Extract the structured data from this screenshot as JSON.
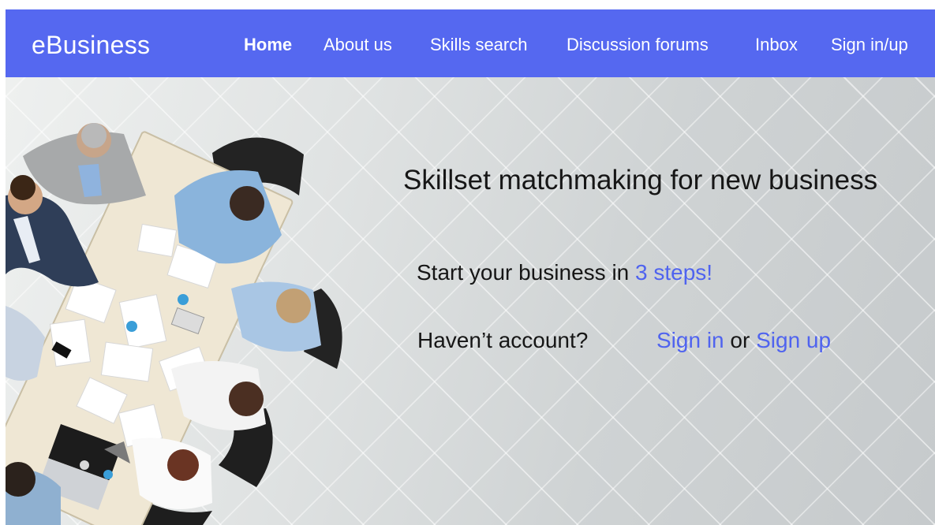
{
  "nav": {
    "brand": "eBusiness",
    "items": [
      {
        "label": "Home",
        "active": true
      },
      {
        "label": "About us",
        "active": false
      },
      {
        "label": "Skills search",
        "active": false
      },
      {
        "label": "Discussion forums",
        "active": false
      },
      {
        "label": "Inbox",
        "active": false
      },
      {
        "label": "Sign in/up",
        "active": false
      }
    ]
  },
  "hero": {
    "headline": "Skillset matchmaking for new business",
    "steps_prefix": "Start your business in ",
    "steps_link": "3 steps!",
    "account_prompt": "Haven’t account?",
    "signin_link": "Sign in",
    "or_text": " or ",
    "signup_link": "Sign up",
    "image": "business-meeting-photo"
  },
  "colors": {
    "navbar": "#5568f0",
    "accent": "#4f63ef",
    "text": "#161616"
  }
}
